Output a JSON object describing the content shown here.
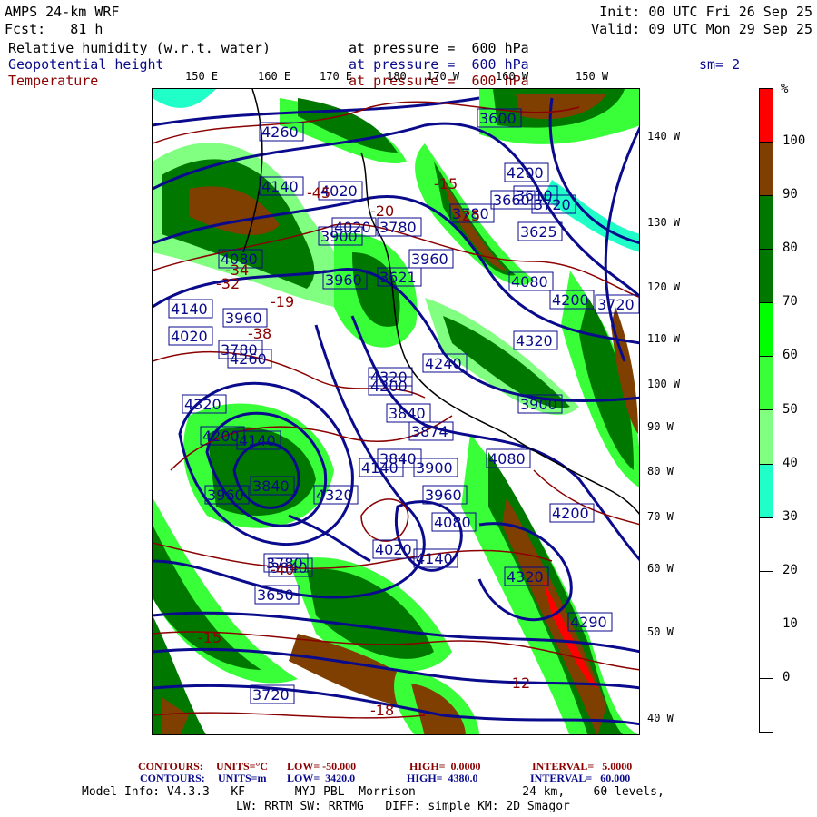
{
  "header": {
    "model": "AMPS 24-km WRF",
    "forecast": "Fcst:   81 h",
    "init": "Init: 00 UTC Fri 26 Sep 25",
    "valid": "Valid: 09 UTC Mon 29 Sep 25",
    "fields": [
      {
        "name": "Relative humidity (w.r.t. water)",
        "level": "at pressure =  600 hPa"
      },
      {
        "name": "Geopotential height",
        "level": "at pressure =  600 hPa"
      },
      {
        "name": "Temperature",
        "level": "at pressure =  600 hPa"
      }
    ],
    "smoothing": "sm= 2"
  },
  "axes": {
    "longitudes": [
      "150 E",
      "160 E",
      "170 E",
      "180",
      "170 W",
      "160 W",
      "150 W"
    ],
    "right_labels": [
      "140 W",
      "130 W",
      "120 W",
      "110 W",
      "100 W",
      "90 W",
      "80 W",
      "70 W",
      "60 W",
      "50 W",
      "40 W"
    ]
  },
  "colorbar": {
    "unit": "%",
    "labels": [
      "100",
      "90",
      "80",
      "70",
      "60",
      "50",
      "40",
      "30",
      "20",
      "10",
      "0"
    ],
    "colors": [
      "#ff0000",
      "#7f3f00",
      "#007800",
      "#007800",
      "#00ff00",
      "#38ff38",
      "#80ff80",
      "#20ffc8",
      "#ffffff",
      "#ffffff",
      "#ffffff",
      "#ffffff"
    ]
  },
  "map": {
    "height_labels": [
      "4260",
      "4200",
      "4140",
      "4020",
      "4020",
      "3780",
      "4080",
      "3621",
      "4140",
      "3960",
      "3780",
      "4020",
      "3720",
      "4320",
      "4260",
      "4320",
      "4200",
      "4140",
      "3840",
      "3960",
      "4140",
      "3780",
      "3720",
      "3840",
      "3600",
      "3650",
      "3610",
      "3720",
      "3660",
      "3780",
      "3625",
      "3960",
      "3900",
      "3960",
      "4080",
      "4200",
      "4320",
      "4240",
      "4200",
      "4320",
      "3840",
      "3874",
      "3900",
      "3840",
      "3900",
      "3960",
      "4080",
      "4080",
      "4200",
      "4020",
      "4140",
      "4320",
      "4290"
    ],
    "temp_labels": [
      "-15",
      "-20",
      "-34",
      "-38",
      "-19",
      "-25",
      "-45",
      "-32",
      "-40",
      "-15",
      "-18",
      "-12"
    ],
    "colors": {
      "height": "#0a0a8c",
      "temperature": "#8b0000"
    }
  },
  "footer": {
    "temp_contours": {
      "label": "CONTOURS:",
      "units": "UNITS=°C",
      "low": "LOW= -50.000",
      "high": "HIGH=  0.0000",
      "interval": "INTERVAL=   5.0000"
    },
    "height_contours": {
      "label": "CONTOURS:",
      "units": "UNITS=m",
      "low": "LOW=  3420.0",
      "high": "HIGH=  4380.0",
      "interval": "INTERVAL=   60.000"
    },
    "model_info_1": "Model Info: V4.3.3   KF       MYJ PBL  Morrison               24 km,    60 levels,",
    "model_info_2": "LW: RRTM SW: RRTMG   DIFF: simple KM: 2D Smagor"
  }
}
